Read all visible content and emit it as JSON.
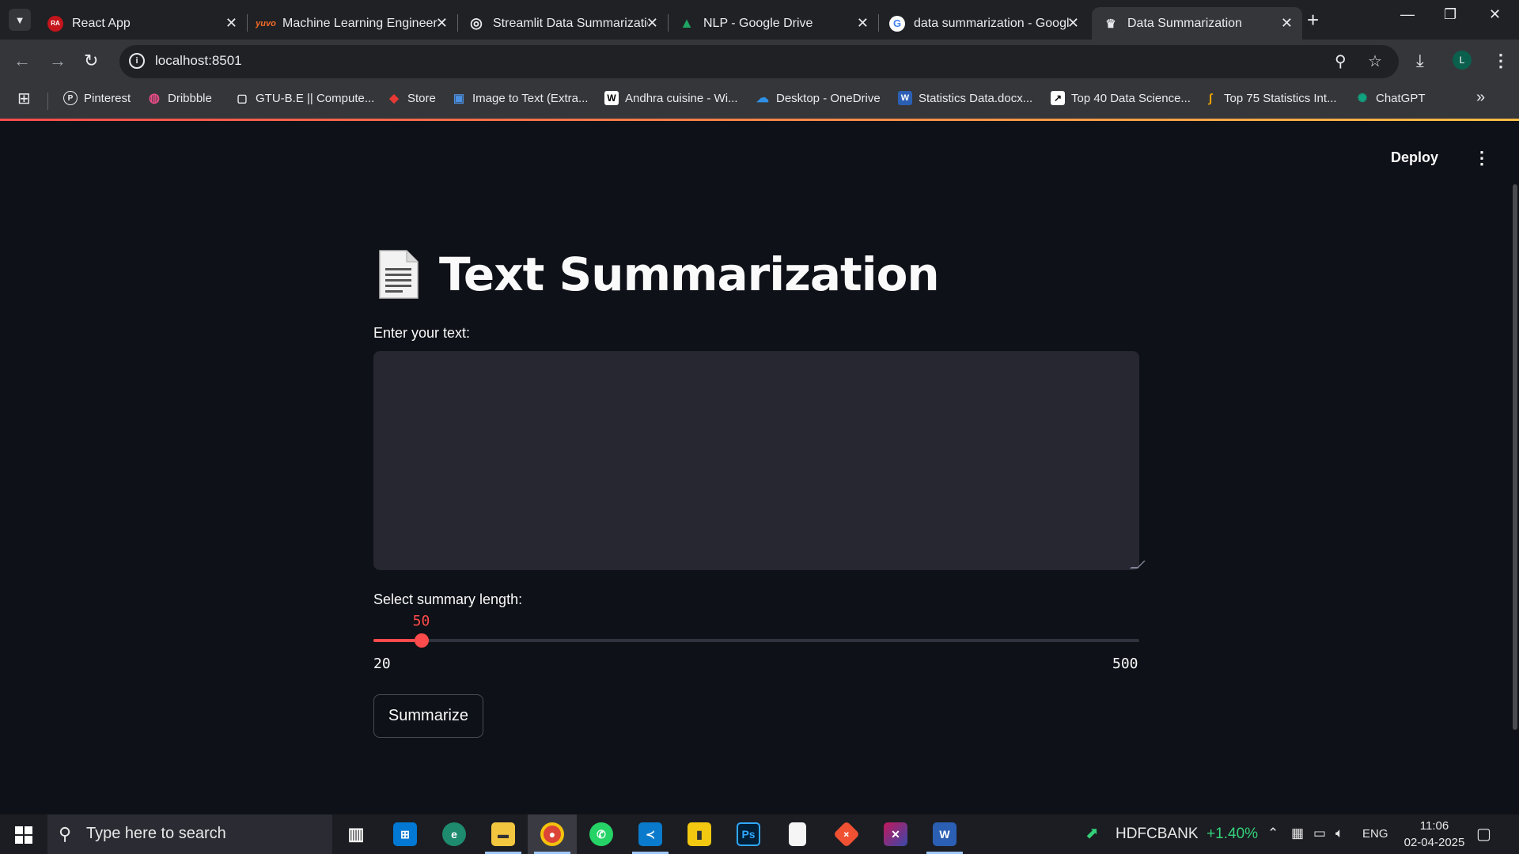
{
  "browser": {
    "tabs": [
      {
        "title": "React App",
        "favicon_text": "RA",
        "favicon_color": "#c4151c"
      },
      {
        "title": "Machine Learning Engineer",
        "favicon_text": "yuvo",
        "favicon_color": "#f46b26"
      },
      {
        "title": "Streamlit Data Summarization",
        "favicon_text": "◎",
        "favicon_color": "#e8eaed"
      },
      {
        "title": "NLP - Google Drive",
        "favicon_text": "▲",
        "favicon_color": "#1fa463"
      },
      {
        "title": "data summarization - Google",
        "favicon_text": "G",
        "favicon_color": "#ffffff"
      },
      {
        "title": "Data Summarization",
        "favicon_text": "♛",
        "favicon_color": "#e8eaed"
      }
    ],
    "active_tab_index": 5,
    "url": "localhost:8501",
    "profile_initial": "L",
    "icons": {
      "tab_search": "chevron-down-icon",
      "back": "arrow-left-icon",
      "forward": "arrow-right-icon",
      "reload": "reload-icon",
      "site_info": "info-icon",
      "zoom": "zoom-icon",
      "bookmark": "star-icon",
      "downloads": "download-icon",
      "menu": "kebab-icon"
    },
    "bookmarks": [
      {
        "label": "Pinterest",
        "icon_text": "P",
        "icon_color": "#e8eaed"
      },
      {
        "label": "Dribbble",
        "icon_text": "◍",
        "icon_color": "#ea4c89"
      },
      {
        "label": "GTU-B.E || Compute...",
        "icon_text": "▢",
        "icon_color": "#e8eaed"
      },
      {
        "label": "Store",
        "icon_text": "◆",
        "icon_color": "#e53935"
      },
      {
        "label": "Image to Text (Extra...",
        "icon_text": "▣",
        "icon_color": "#4a90e2"
      },
      {
        "label": "Andhra cuisine - Wi...",
        "icon_text": "W",
        "icon_color": "#ffffff"
      },
      {
        "label": "Desktop - OneDrive",
        "icon_text": "☁",
        "icon_color": "#2f8fe6"
      },
      {
        "label": "Statistics Data.docx...",
        "icon_text": "W",
        "icon_color": "#2b5fb4"
      },
      {
        "label": "Top 40 Data Science...",
        "icon_text": "↗",
        "icon_color": "#ffffff"
      },
      {
        "label": "Top 75 Statistics Int...",
        "icon_text": "∫",
        "icon_color": "#f0a500"
      },
      {
        "label": "ChatGPT",
        "icon_text": "✺",
        "icon_color": "#10a37f"
      }
    ]
  },
  "app": {
    "deploy_label": "Deploy",
    "title_emoji": "page-facing-up-icon",
    "title": "Text Summarization",
    "text_input": {
      "label": "Enter your text:",
      "value": "",
      "placeholder": ""
    },
    "slider": {
      "label": "Select summary length:",
      "min": 20,
      "max": 500,
      "value": 50,
      "min_label": "20",
      "max_label": "500",
      "value_label": "50"
    },
    "summarize_label": "Summarize",
    "accent_color": "#ff4b4b"
  },
  "taskbar": {
    "search_placeholder": "Type here to search",
    "apps": [
      {
        "name": "task-view",
        "glyph": "▥",
        "color": "transparent"
      },
      {
        "name": "microsoft-store",
        "glyph": "⊞",
        "color": "#0078d4"
      },
      {
        "name": "edge",
        "glyph": "e",
        "color": "#1e8a6e"
      },
      {
        "name": "file-explorer",
        "glyph": "▬",
        "color": "#f3c640"
      },
      {
        "name": "chrome",
        "glyph": "◉",
        "color": "#db4437"
      },
      {
        "name": "whatsapp",
        "glyph": "✆",
        "color": "#25d366"
      },
      {
        "name": "vscode",
        "glyph": "≺",
        "color": "#0a7acc"
      },
      {
        "name": "power-bi",
        "glyph": "▮",
        "color": "#f2c811"
      },
      {
        "name": "photoshop",
        "glyph": "Ps",
        "color": "#001e36"
      },
      {
        "name": "notepad",
        "glyph": "▯",
        "color": "#f5f5f5"
      },
      {
        "name": "git",
        "glyph": "◆",
        "color": "#f05133"
      },
      {
        "name": "ide",
        "glyph": "✕",
        "color": "#c2185b"
      },
      {
        "name": "word",
        "glyph": "W",
        "color": "#2b5fb4"
      }
    ],
    "stock": {
      "symbol": "HDFCBANK",
      "change": "+1.40%"
    },
    "language": "ENG",
    "time": "11:06",
    "date": "02-04-2025"
  }
}
